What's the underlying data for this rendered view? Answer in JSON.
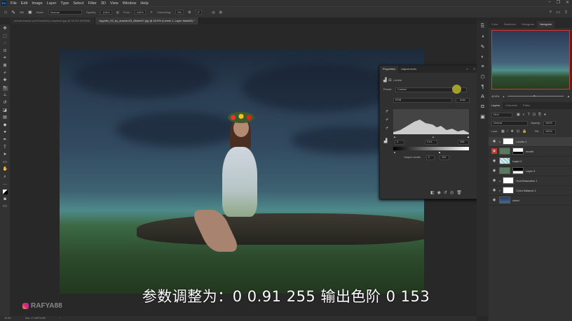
{
  "app": {
    "logo": "Ps",
    "menu": [
      "File",
      "Edit",
      "Image",
      "Layer",
      "Type",
      "Select",
      "Filter",
      "3D",
      "View",
      "Window",
      "Help"
    ]
  },
  "options": {
    "mode_label": "Mode:",
    "mode": "Normal",
    "opacity_label": "Opacity:",
    "opacity": "100%",
    "flow_label": "Flow:",
    "flow": "100%",
    "smoothing_label": "Smoothing:",
    "smoothing": "0%",
    "brush_size": "300",
    "angle": "0°"
  },
  "tabs": [
    {
      "label": "emma-francis-vpHCfunwDrQ-unsplash.jpg @ 33.3% (RGB/8)"
    },
    {
      "label": "layyalin_03_by_anandu23_d6dmt47.jpg @ 40.6% (Levels 1, Layer Mask/8) *"
    }
  ],
  "properties": {
    "tab_properties": "Properties",
    "tab_adjustments": "Adjustments",
    "title": "Levels",
    "preset_label": "Preset:",
    "preset": "Custom",
    "channel": "RGB",
    "auto": "Auto",
    "input_black": "0",
    "input_gamma": "0.91",
    "input_white": "255",
    "output_label": "Output Levels:",
    "output_black": "0",
    "output_white": "153"
  },
  "right_panel": {
    "tabs": [
      "Color",
      "Swatches",
      "Histogram",
      "Navigator"
    ],
    "nav_zoom": "40.6%",
    "layer_tabs": [
      "Layers",
      "Channels",
      "Paths"
    ],
    "kind": "Kind",
    "blend": "Normal",
    "opacity_label": "Opacity:",
    "opacity": "100%",
    "lock_label": "Lock:",
    "fill_label": "Fill:",
    "fill": "100%",
    "layers": [
      {
        "name": "Levels 1",
        "selected": true
      },
      {
        "name": "model",
        "red_eye": true
      },
      {
        "name": "Layer 2"
      },
      {
        "name": "Layer 3"
      },
      {
        "name": "Hue/Saturation 1"
      },
      {
        "name": "Color Balance 1"
      },
      {
        "name": "cloud"
      }
    ]
  },
  "status": {
    "zoom": "40.6%",
    "doc": "Doc: 17.2M/76.4M"
  },
  "subtitle": "参数调整为：0 0.91 255  输出色阶 0 153",
  "watermark": "RAFYA88"
}
